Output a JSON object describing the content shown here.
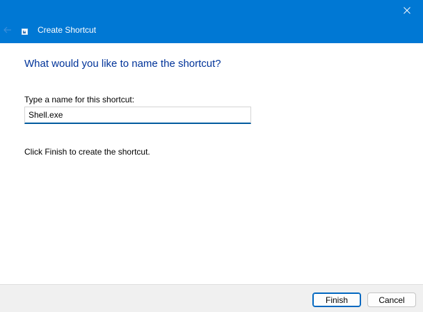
{
  "wizard": {
    "title": "Create Shortcut",
    "heading": "What would you like to name the shortcut?",
    "name_label": "Type a name for this shortcut:",
    "name_value": "Shell.exe",
    "hint": "Click Finish to create the shortcut."
  },
  "buttons": {
    "finish": "Finish",
    "cancel": "Cancel"
  },
  "colors": {
    "titlebar": "#0078d4",
    "heading": "#003399",
    "accent": "#0067c0"
  },
  "icons": {
    "close": "close-icon",
    "back": "back-arrow-icon",
    "wizard": "shortcut-icon"
  }
}
